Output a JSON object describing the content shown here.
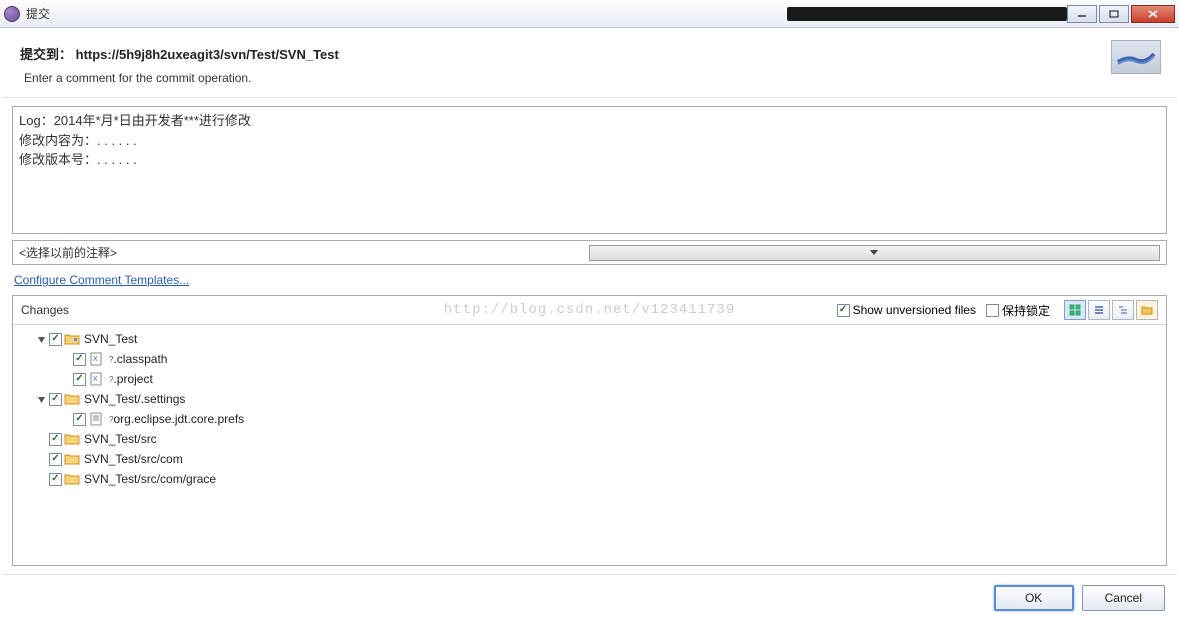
{
  "window": {
    "title": "提交"
  },
  "header": {
    "title_prefix": "提交到：",
    "url": "https://5h9j8h2uxeagit3/svn/Test/SVN_Test",
    "subtitle": "Enter a comment for the commit operation."
  },
  "comment": {
    "line1": "Log：2014年*月*日由开发者***进行修改",
    "line2": "修改内容为：. . . . . .",
    "line3": "修改版本号：. . . . . ."
  },
  "prev_comments": {
    "placeholder": "<选择以前的注释>"
  },
  "links": {
    "configure_templates": "Configure Comment Templates..."
  },
  "changes": {
    "label": "Changes",
    "watermark": "http://blog.csdn.net/v123411739",
    "show_unversioned": "Show unversioned files",
    "keep_locks": "保持锁定"
  },
  "tree": [
    {
      "level": 0,
      "arrow": "down",
      "checked": true,
      "icon": "proj-folder",
      "label": "SVN_Test"
    },
    {
      "level": 1,
      "arrow": "none",
      "checked": true,
      "icon": "xml-file",
      "ovl": "?",
      "label": ".classpath"
    },
    {
      "level": 1,
      "arrow": "none",
      "checked": true,
      "icon": "xml-file",
      "ovl": "?",
      "label": ".project"
    },
    {
      "level": 0,
      "arrow": "down",
      "checked": true,
      "icon": "folder",
      "label": "SVN_Test/.settings"
    },
    {
      "level": 1,
      "arrow": "none",
      "checked": true,
      "icon": "text-file",
      "ovl": "?",
      "label": "org.eclipse.jdt.core.prefs"
    },
    {
      "level": 0,
      "arrow": "none",
      "checked": true,
      "icon": "folder",
      "label": "SVN_Test/src"
    },
    {
      "level": 0,
      "arrow": "none",
      "checked": true,
      "icon": "folder",
      "label": "SVN_Test/src/com"
    },
    {
      "level": 0,
      "arrow": "none",
      "checked": true,
      "icon": "folder",
      "label": "SVN_Test/src/com/grace"
    }
  ],
  "buttons": {
    "ok": "OK",
    "cancel": "Cancel"
  }
}
